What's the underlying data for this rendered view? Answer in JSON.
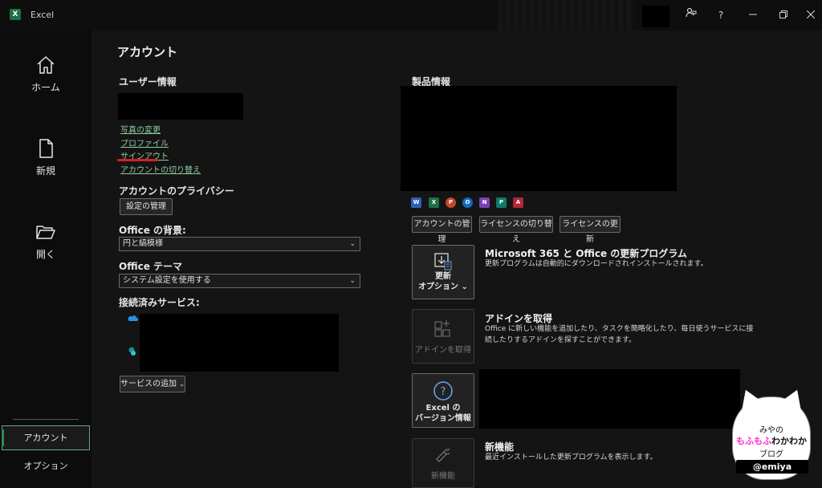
{
  "titlebar": {
    "app_name": "Excel",
    "app_letter": "X",
    "help": "?"
  },
  "sidebar": {
    "home": "ホーム",
    "new": "新規",
    "open": "開く",
    "account": "アカウント",
    "options": "オプション"
  },
  "page_title": "アカウント",
  "user_info": {
    "heading": "ユーザー情報",
    "links": [
      "写真の変更",
      "プロファイル",
      "サインアウト",
      "アカウントの切り替え"
    ]
  },
  "privacy": {
    "heading": "アカウントのプライバシー",
    "button": "設定の管理"
  },
  "background": {
    "heading": "Office の背景:",
    "value": "円と縞模様"
  },
  "theme": {
    "heading": "Office テーマ",
    "value": "システム設定を使用する"
  },
  "services": {
    "heading": "接続済みサービス:",
    "add_button": "サービスの追加"
  },
  "product": {
    "heading": "製品情報",
    "app_letters": [
      "W",
      "X",
      "P",
      "O",
      "N",
      "P",
      "A"
    ],
    "buttons": [
      "アカウントの管理",
      "ライセンスの切り替え",
      "ライセンスの更新"
    ]
  },
  "updates": {
    "tile_line1": "更新",
    "tile_line2": "オプション",
    "title": "Microsoft 365 と Office の更新プログラム",
    "desc": "更新プログラムは自動的にダウンロードされインストールされます。"
  },
  "addins": {
    "tile": "アドインを取得",
    "title": "アドインを取得",
    "desc": "Office に新しい機能を追加したり、タスクを簡略化したり、毎日使うサービスに接続したりするアドインを探すことができます。"
  },
  "about": {
    "tile_line1": "Excel の",
    "tile_line2": "バージョン情報"
  },
  "whats_new": {
    "tile": "新機能",
    "title": "新機能",
    "desc": "最近インストールした更新プログラムを表示します。"
  },
  "watermark": {
    "line1": "みやの",
    "line2a": "もふもふ",
    "line2b": "わかわか",
    "line3": "ブログ",
    "line4": "@emiya"
  },
  "colors": {
    "accent_green": "#2b8a50",
    "link_green": "#8fcf9f",
    "signout_underline": "#d42020",
    "watermark_pink": "#ff2bd2"
  }
}
